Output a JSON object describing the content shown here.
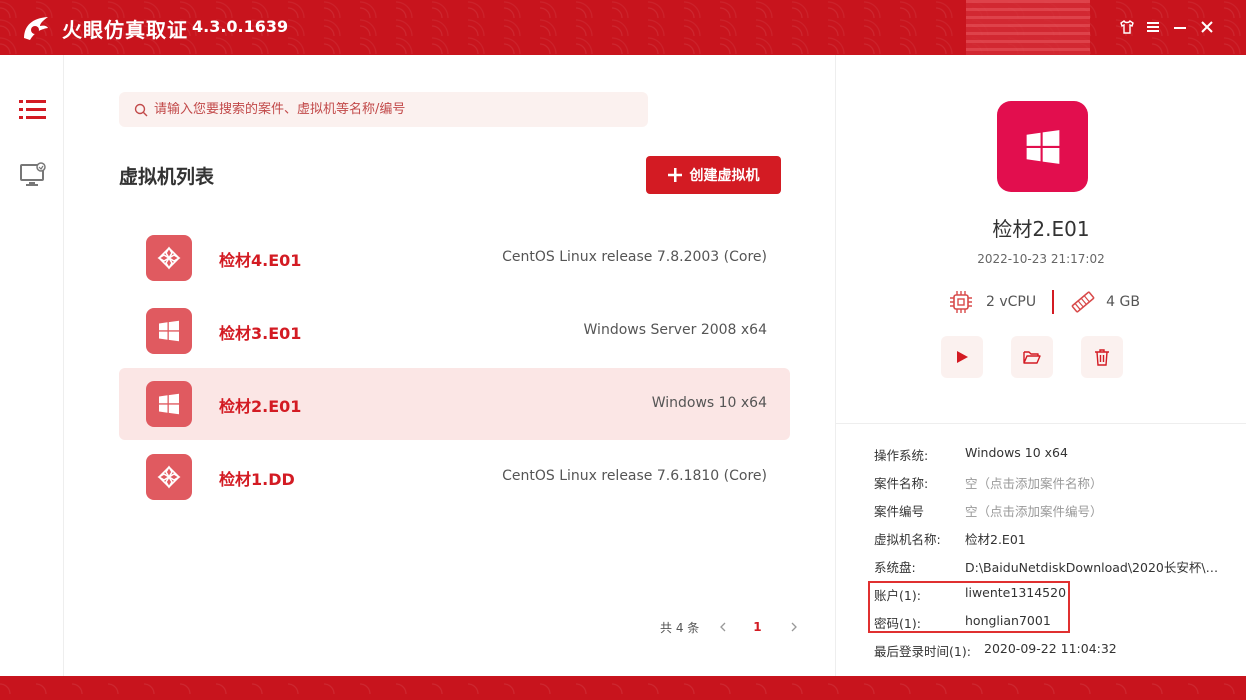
{
  "app": {
    "title": "火眼仿真取证",
    "version": "4.3.0.1639"
  },
  "search": {
    "placeholder": "请输入您要搜索的案件、虚拟机等名称/编号"
  },
  "list": {
    "title": "虚拟机列表",
    "create_label": "创建虚拟机",
    "items": [
      {
        "name": "检材4.E01",
        "os": "CentOS Linux release 7.8.2003 (Core)",
        "icon": "centos-icon"
      },
      {
        "name": "检材3.E01",
        "os": "Windows Server 2008 x64",
        "icon": "windows-icon"
      },
      {
        "name": "检材2.E01",
        "os": "Windows 10 x64",
        "icon": "windows-icon",
        "selected": true
      },
      {
        "name": "检材1.DD",
        "os": "CentOS Linux release 7.6.1810 (Core)",
        "icon": "centos-icon"
      }
    ]
  },
  "pager": {
    "total": "共 4 条",
    "current": "1"
  },
  "detail": {
    "name": "检材2.E01",
    "created": "2022-10-23 21:17:02",
    "cpu": "2 vCPU",
    "memory": "4 GB",
    "info": [
      {
        "label": "操作系统:",
        "value": "Windows 10 x64"
      },
      {
        "label": "案件名称:",
        "value": "空（点击添加案件名称）"
      },
      {
        "label": "案件编号",
        "value": "空（点击添加案件编号）"
      },
      {
        "label": "虚拟机名称:",
        "value": "检材2.E01"
      },
      {
        "label": "系统盘:",
        "value": "D:\\BaiduNetdiskDownload\\2020长安杯\\…"
      },
      {
        "label": "账户(1):",
        "value": "liwente1314520"
      },
      {
        "label": "密码(1):",
        "value": "honglian7001"
      },
      {
        "label": "最后登录时间(1):",
        "value": "2020-09-22 11:04:32"
      }
    ]
  },
  "colors": {
    "accent": "#d31b23",
    "selected_row": "#fbe6e5",
    "big_icon": "#e20e4e"
  }
}
